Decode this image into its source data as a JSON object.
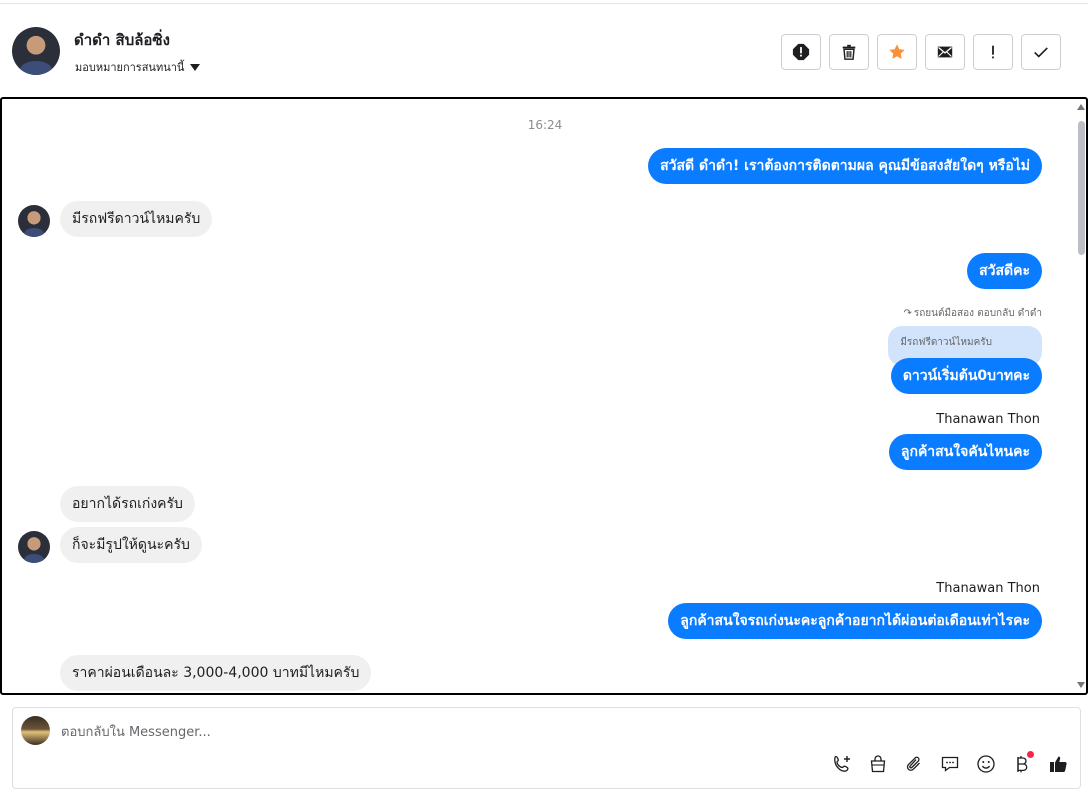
{
  "header": {
    "contact_name": "ดำดำ สิบล้อซิ่ง",
    "assign_label": "มอบหมายการสนทนานี้",
    "actions": [
      {
        "icon": "alert-circle-icon",
        "label": "spam"
      },
      {
        "icon": "trash-icon",
        "label": "delete"
      },
      {
        "icon": "star-icon",
        "label": "star"
      },
      {
        "icon": "envelope-icon",
        "label": "mark-unread"
      },
      {
        "icon": "exclamation-icon",
        "label": "follow-up"
      },
      {
        "icon": "check-icon",
        "label": "done"
      }
    ],
    "star_color": "#f7923b"
  },
  "chat": {
    "timestamp": "16:24",
    "messages": [
      {
        "dir": "out",
        "text": "สวัสดี ดำดำ! เราต้องการติดตามผล คุณมีข้อสงสัยใดๆ หรือไม่"
      },
      {
        "dir": "in",
        "text": "มีรถฟรีดาวน์ไหมครับ"
      },
      {
        "dir": "out",
        "text": "สวัสดีคะ"
      },
      {
        "dir": "out",
        "reply_meta": "รถยนต์มือสอง ตอบกลับ ดำดำ",
        "quoted": "มีรถฟรีดาวน์ไหมครับ",
        "text": "ดาวน์เริ่มต้น0บาทคะ"
      },
      {
        "dir": "out",
        "sender": "Thanawan Thon",
        "text": "ลูกค้าสนใจคันไหนคะ"
      },
      {
        "dir": "in",
        "text": "อยากได้รถเก่งครับ"
      },
      {
        "dir": "in",
        "text": "ก็จะมีรูปให้ดูนะครับ"
      },
      {
        "dir": "out",
        "sender": "Thanawan Thon",
        "text": "ลูกค้าสนใจรถเก่งนะคะลูกค้าอยากได้ผ่อนต่อเดือนเท่าไรคะ"
      },
      {
        "dir": "in",
        "text": "ราคาผ่อนเดือนละ 3,000-4,000 บาทมีไหมครับ"
      }
    ],
    "outgoing_color": "#0a7cff",
    "incoming_color": "#f0f0f0"
  },
  "composer": {
    "placeholder": "ตอบกลับใน Messenger...",
    "tools": [
      "phone-add-icon",
      "shopping-bag-icon",
      "paperclip-icon",
      "chat-bubble-icon",
      "smiley-icon",
      "baht-icon",
      "thumbs-up-icon"
    ]
  }
}
